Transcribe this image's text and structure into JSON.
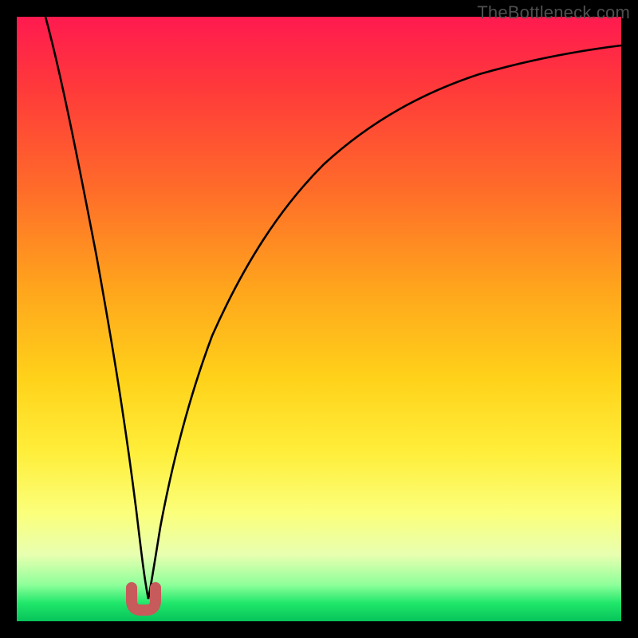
{
  "watermark": {
    "text": "TheBottleneck.com"
  },
  "chart_data": {
    "type": "line",
    "title": "",
    "xlabel": "",
    "ylabel": "",
    "xlim": [
      0,
      100
    ],
    "ylim": [
      0,
      100
    ],
    "grid": false,
    "background_gradient": {
      "top_color": "#ff1a4f",
      "bottom_color": "#06c45a",
      "meaning": "high bottleneck (red) to low bottleneck (green)"
    },
    "series": [
      {
        "name": "bottleneck-curve",
        "color": "#000000",
        "x": [
          5,
          7,
          9,
          11,
          13,
          15,
          17,
          18.5,
          19.5,
          20.5,
          21.5,
          22.5,
          24,
          26,
          29,
          33,
          38,
          44,
          51,
          59,
          68,
          78,
          89,
          100
        ],
        "y": [
          100,
          88,
          76,
          64,
          52,
          40,
          28,
          16,
          8,
          3,
          3,
          8,
          18,
          30,
          42,
          52,
          61,
          68,
          74,
          79,
          83,
          86,
          89,
          91
        ]
      }
    ],
    "marker": {
      "name": "optimal-point-marker",
      "shape": "u-link",
      "color": "#c75a5a",
      "x_center": 20.5,
      "y_center": 2.5,
      "width": 5,
      "height": 5
    }
  }
}
